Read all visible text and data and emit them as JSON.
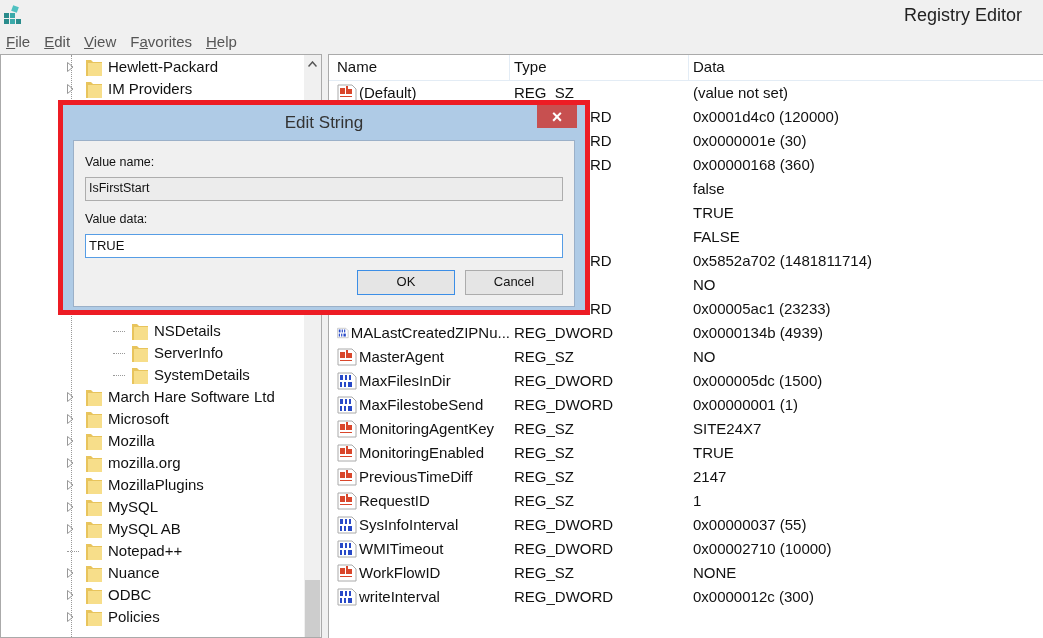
{
  "window": {
    "title": "Registry Editor"
  },
  "menu": [
    {
      "key": "F",
      "post": "ile"
    },
    {
      "key": "E",
      "post": "dit"
    },
    {
      "key": "V",
      "post": "iew"
    },
    {
      "pre": "F",
      "key": "a",
      "post": "vorites"
    },
    {
      "key": "H",
      "post": "elp"
    }
  ],
  "tree": [
    {
      "label": "Hewlett-Packard",
      "expandable": true
    },
    {
      "label": "IM Providers",
      "expandable": true
    },
    {
      "children": [
        {
          "label": "NSDetails",
          "expandable": false
        },
        {
          "label": "ServerInfo",
          "expandable": false
        },
        {
          "label": "SystemDetails",
          "expandable": false
        }
      ]
    },
    {
      "label": "March Hare Software Ltd",
      "expandable": true
    },
    {
      "label": "Microsoft",
      "expandable": true
    },
    {
      "label": "Mozilla",
      "expandable": true
    },
    {
      "label": "mozilla.org",
      "expandable": true
    },
    {
      "label": "MozillaPlugins",
      "expandable": true
    },
    {
      "label": "MySQL",
      "expandable": true
    },
    {
      "label": "MySQL AB",
      "expandable": true
    },
    {
      "label": "Notepad++",
      "expandable": false
    },
    {
      "label": "Nuance",
      "expandable": true
    },
    {
      "label": "ODBC",
      "expandable": true
    },
    {
      "label": "Policies",
      "expandable": true
    }
  ],
  "table": {
    "columns": [
      "Name",
      "Type",
      "Data"
    ],
    "rows": [
      {
        "kind": "sz",
        "name": "(Default)",
        "type": "REG_SZ",
        "data": "(value not set)"
      },
      {
        "type": "RD",
        "data": "0x0001d4c0 (120000)"
      },
      {
        "type": "RD",
        "data": "0x0000001e (30)"
      },
      {
        "type": "RD",
        "data": "0x00000168 (360)"
      },
      {
        "data": "false"
      },
      {
        "data": "TRUE"
      },
      {
        "data": "FALSE"
      },
      {
        "type": "RD",
        "data": "0x5852a702 (1481811714)"
      },
      {
        "data": "NO"
      },
      {
        "type": "RD",
        "data": "0x00005ac1 (23233)"
      },
      {
        "kind": "dword",
        "name": "MALastCreatedZIPNu...",
        "type": "REG_DWORD",
        "data": "0x0000134b (4939)"
      },
      {
        "kind": "sz",
        "name": "MasterAgent",
        "type": "REG_SZ",
        "data": "NO"
      },
      {
        "kind": "dword",
        "name": "MaxFilesInDir",
        "type": "REG_DWORD",
        "data": "0x000005dc (1500)"
      },
      {
        "kind": "dword",
        "name": "MaxFilestobeSend",
        "type": "REG_DWORD",
        "data": "0x00000001 (1)"
      },
      {
        "kind": "sz",
        "name": "MonitoringAgentKey",
        "type": "REG_SZ",
        "data": "SITE24X7"
      },
      {
        "kind": "sz",
        "name": "MonitoringEnabled",
        "type": "REG_SZ",
        "data": "TRUE"
      },
      {
        "kind": "sz",
        "name": "PreviousTimeDiff",
        "type": "REG_SZ",
        "data": "2147"
      },
      {
        "kind": "sz",
        "name": "RequestID",
        "type": "REG_SZ",
        "data": "1"
      },
      {
        "kind": "dword",
        "name": "SysInfoInterval",
        "type": "REG_DWORD",
        "data": "0x00000037 (55)"
      },
      {
        "kind": "dword",
        "name": "WMITimeout",
        "type": "REG_DWORD",
        "data": "0x00002710 (10000)"
      },
      {
        "kind": "sz",
        "name": "WorkFlowID",
        "type": "REG_SZ",
        "data": "NONE"
      },
      {
        "kind": "dword",
        "name": "writeInterval",
        "type": "REG_DWORD",
        "data": "0x0000012c (300)"
      }
    ]
  },
  "dialog": {
    "title": "Edit String",
    "close": "×",
    "name_label": "Value name:",
    "name_value": "IsFirstStart",
    "data_label": "Value data:",
    "data_value": "TRUE",
    "buttons": [
      "OK",
      "Cancel"
    ]
  }
}
